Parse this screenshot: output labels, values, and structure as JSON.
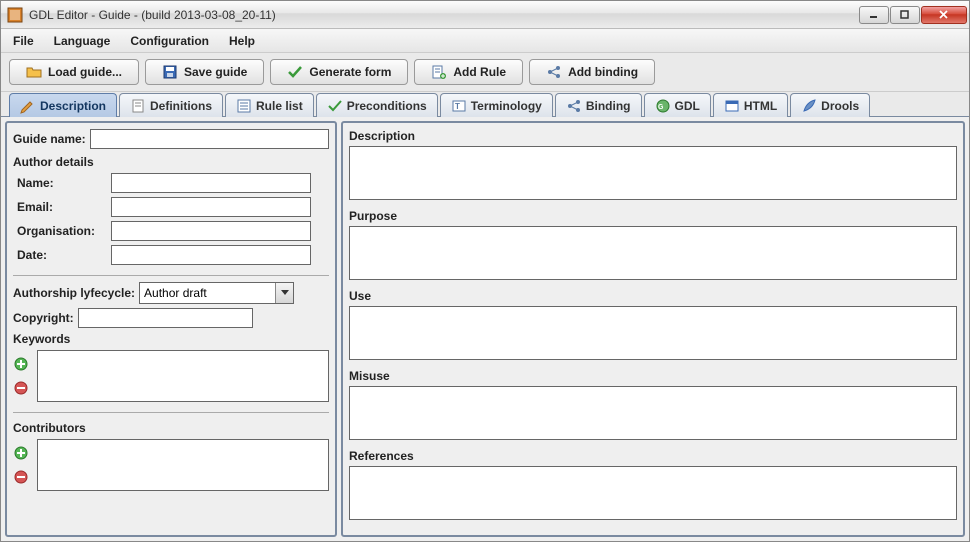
{
  "window": {
    "title": "GDL Editor - Guide - (build 2013-03-08_20-11)"
  },
  "menubar": [
    "File",
    "Language",
    "Configuration",
    "Help"
  ],
  "toolbar": {
    "load": "Load guide...",
    "save": "Save guide",
    "generate": "Generate form",
    "addrule": "Add Rule",
    "addbinding": "Add binding"
  },
  "tabs": [
    "Description",
    "Definitions",
    "Rule list",
    "Preconditions",
    "Terminology",
    "Binding",
    "GDL",
    "HTML",
    "Drools"
  ],
  "left": {
    "guide_name_label": "Guide name:",
    "guide_name_value": "",
    "author_details_title": "Author details",
    "name_label": "Name:",
    "name_value": "",
    "email_label": "Email:",
    "email_value": "",
    "org_label": "Organisation:",
    "org_value": "",
    "date_label": "Date:",
    "date_value": "",
    "lifecycle_label": "Authorship lyfecycle:",
    "lifecycle_value": "Author draft",
    "copyright_label": "Copyright:",
    "copyright_value": "",
    "keywords_title": "Keywords",
    "contributors_title": "Contributors"
  },
  "right": {
    "description_label": "Description",
    "purpose_label": "Purpose",
    "use_label": "Use",
    "misuse_label": "Misuse",
    "references_label": "References"
  }
}
